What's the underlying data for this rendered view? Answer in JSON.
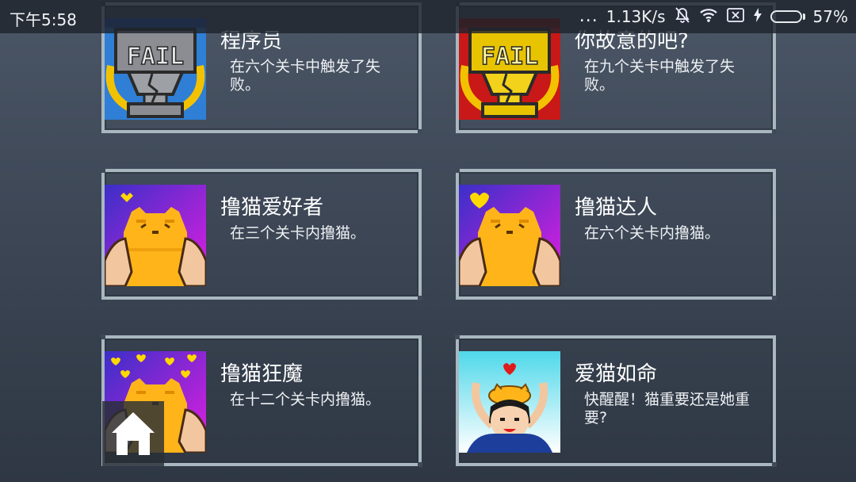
{
  "status_bar": {
    "time": "下午5:58",
    "more": "...",
    "network_speed": "1.13K/s",
    "battery_percent": "57%",
    "battery_level": 0.57,
    "battery_color": "#3ddc37"
  },
  "achievements": [
    {
      "title": "程序员",
      "description": "在六个关卡中触发了失败。",
      "icon": "fail-trophy-silver-icon"
    },
    {
      "title": "你故意的吧?",
      "description": "在九个关卡中触发了失败。",
      "icon": "fail-trophy-gold-icon"
    },
    {
      "title": "撸猫爱好者",
      "description": "在三个关卡内撸猫。",
      "icon": "petting-cat-icon"
    },
    {
      "title": "撸猫达人",
      "description": "在六个关卡内撸猫。",
      "icon": "petting-cat-heart-icon"
    },
    {
      "title": "撸猫狂魔",
      "description": "在十二个关卡内撸猫。",
      "icon": "petting-cat-hearts-icon"
    },
    {
      "title": "爱猫如命",
      "description": "快醒醒！猫重要还是她重要?",
      "icon": "cat-on-head-icon"
    }
  ],
  "home_button": {
    "icon": "home-icon"
  }
}
